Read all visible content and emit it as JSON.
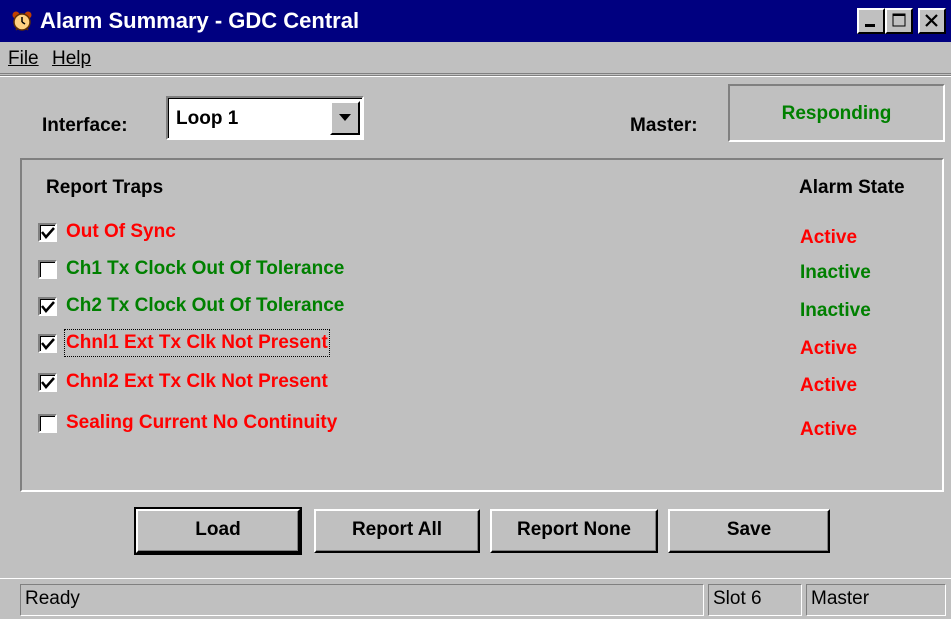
{
  "window": {
    "title": "Alarm Summary - GDC Central",
    "icon": "alarm-clock-icon",
    "controls": [
      "minimize-icon",
      "maximize-icon",
      "close-icon"
    ]
  },
  "menu": {
    "file": "File",
    "help": "Help"
  },
  "interface": {
    "label": "Interface:",
    "selected": "Loop 1"
  },
  "master": {
    "label": "Master:",
    "status": "Responding"
  },
  "headers": {
    "traps": "Report Traps",
    "state": "Alarm State"
  },
  "traps": [
    {
      "label": "Out Of Sync",
      "checked": true,
      "state": "Active"
    },
    {
      "label": "Ch1 Tx Clock Out Of Tolerance",
      "checked": false,
      "state": "Inactive"
    },
    {
      "label": "Ch2 Tx Clock Out Of Tolerance",
      "checked": true,
      "state": "Inactive"
    },
    {
      "label": "Chnl1 Ext Tx Clk Not Present",
      "checked": true,
      "state": "Active"
    },
    {
      "label": "Chnl2 Ext Tx Clk Not Present",
      "checked": true,
      "state": "Active"
    },
    {
      "label": "Sealing Current No Continuity",
      "checked": false,
      "state": "Active"
    }
  ],
  "buttons": {
    "load": "Load",
    "report_all": "Report All",
    "report_none": "Report None",
    "save": "Save"
  },
  "statusbar": {
    "message": "Ready",
    "slot": "Slot 6",
    "role": "Master"
  },
  "colors": {
    "title_bar": "#000080",
    "active": "#ff0000",
    "inactive": "#008000",
    "responding": "#008000"
  }
}
